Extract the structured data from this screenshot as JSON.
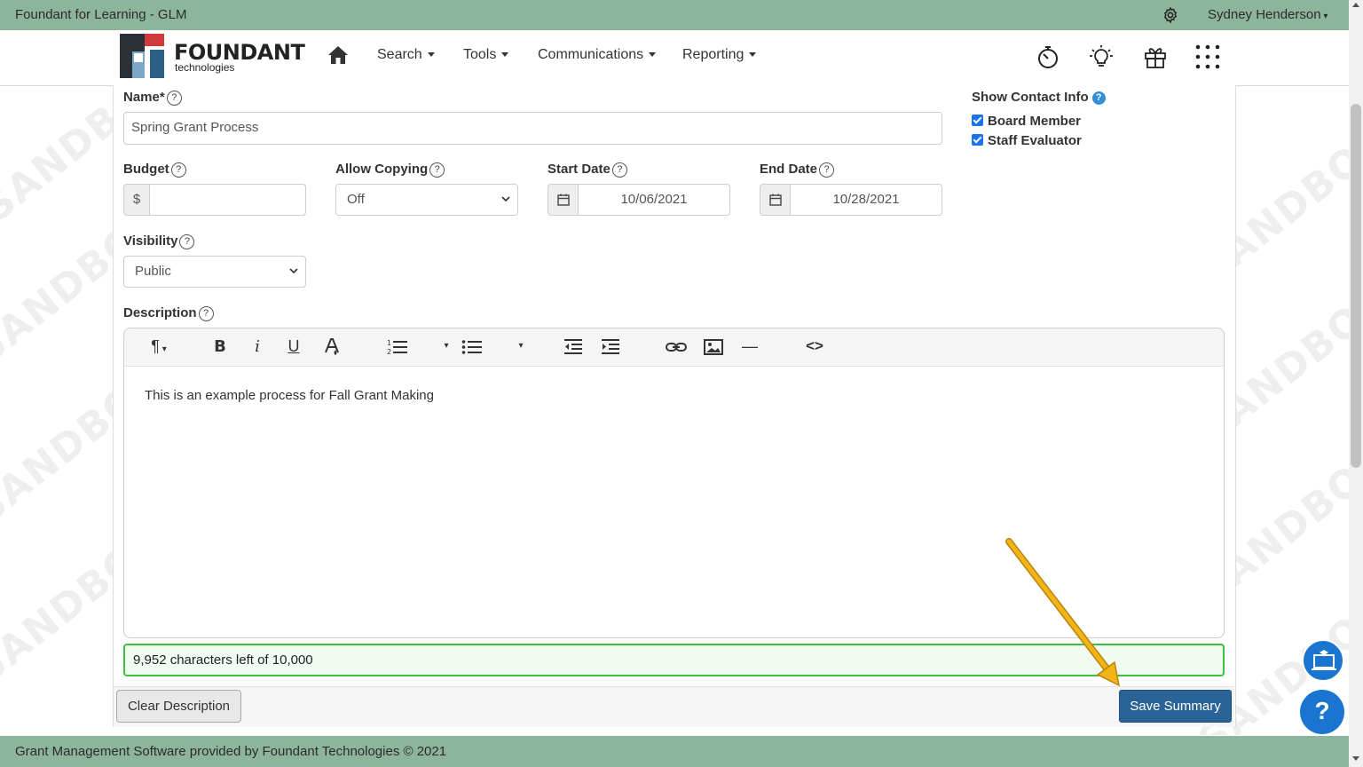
{
  "topbar": {
    "app_title": "Foundant for Learning - GLM",
    "user_name": "Sydney Henderson"
  },
  "logo": {
    "word": "FOUNDANT",
    "sub": "technologies"
  },
  "nav": {
    "search": "Search",
    "tools": "Tools",
    "communications": "Communications",
    "reporting": "Reporting"
  },
  "form": {
    "name_label": "Name*",
    "name_value": "Spring Grant Process",
    "budget_label": "Budget",
    "budget_currency": "$",
    "budget_value": "",
    "allow_copying_label": "Allow Copying",
    "allow_copying_value": "Off",
    "start_date_label": "Start Date",
    "start_date_value": "10/06/2021",
    "end_date_label": "End Date",
    "end_date_value": "10/28/2021",
    "visibility_label": "Visibility",
    "visibility_value": "Public",
    "description_label": "Description",
    "description_text": "This is an example process for Fall Grant Making",
    "char_counter": "9,952 characters left of 10,000"
  },
  "contact": {
    "title": "Show Contact Info",
    "options": [
      {
        "label": "Board Member",
        "checked": true
      },
      {
        "label": "Staff Evaluator",
        "checked": true
      }
    ]
  },
  "buttons": {
    "clear": "Clear Description",
    "save": "Save Summary"
  },
  "footer": {
    "text": "Grant Management Software provided by Foundant Technologies © 2021"
  },
  "watermark": "SANDBOX",
  "colors": {
    "header_green": "#8db59c",
    "save_blue": "#2a6496",
    "counter_green": "#3cc13c",
    "arrow_yellow": "#f2b418"
  },
  "icons": [
    "gear-icon",
    "home-icon",
    "stopwatch-icon",
    "lightbulb-icon",
    "gift-icon",
    "apps-grid-icon",
    "calendar-icon",
    "help-icon",
    "info-icon",
    "classroom-icon",
    "question-icon"
  ]
}
